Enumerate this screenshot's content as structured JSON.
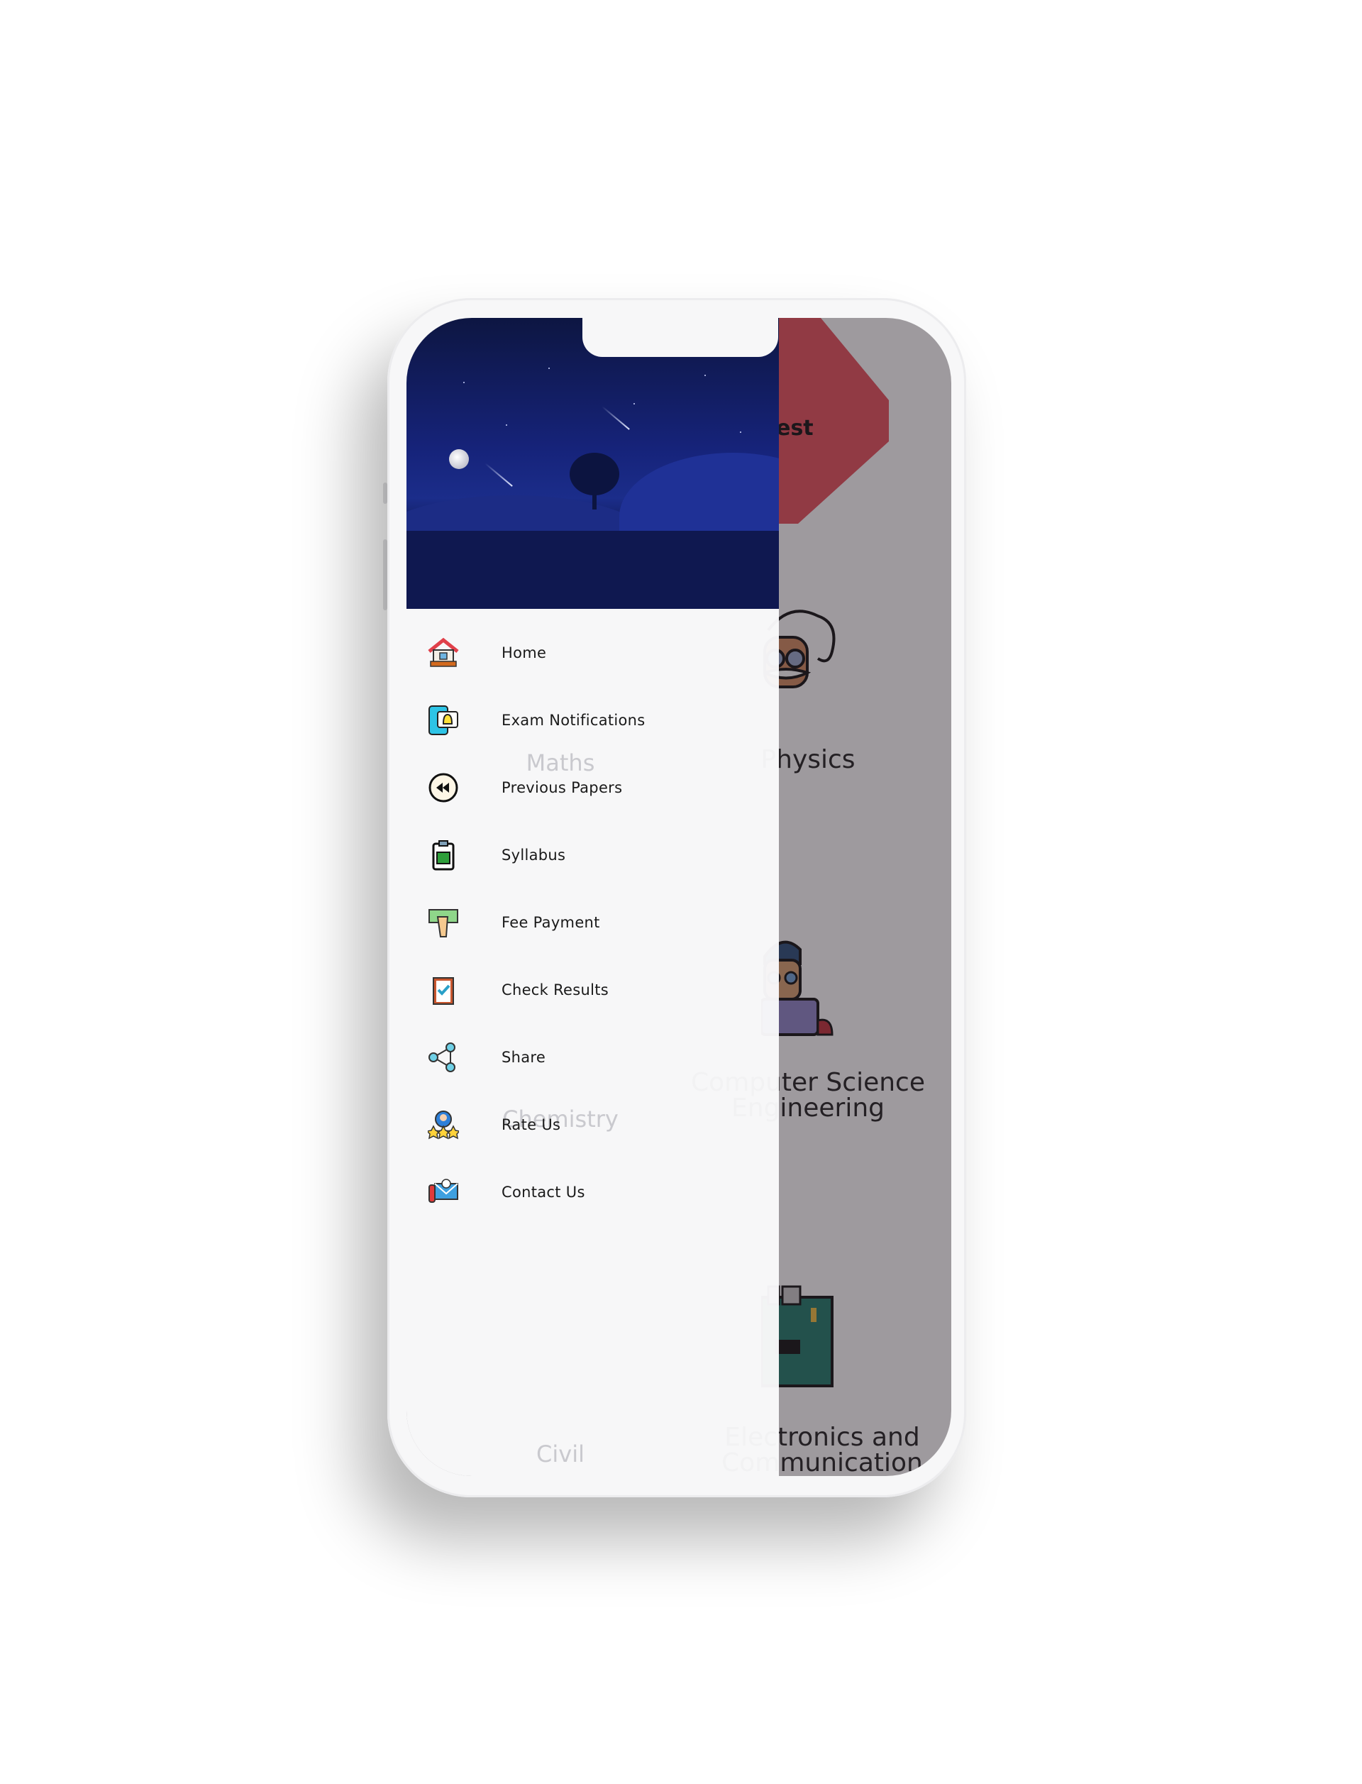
{
  "app": {
    "banner_text": "your test",
    "subjects": [
      "Maths",
      "Physics",
      "Chemistry",
      "Computer Science Engineering",
      "Civil",
      "Electronics and Communication"
    ]
  },
  "drawer": {
    "items": [
      {
        "label": "Home",
        "icon": "home-icon"
      },
      {
        "label": "Exam Notifications",
        "icon": "notification-bell-icon"
      },
      {
        "label": "Previous Papers",
        "icon": "rewind-icon"
      },
      {
        "label": "Syllabus",
        "icon": "clipboard-book-icon"
      },
      {
        "label": "Fee Payment",
        "icon": "money-hand-icon"
      },
      {
        "label": "Check Results",
        "icon": "clipboard-check-icon"
      },
      {
        "label": "Share",
        "icon": "share-icon"
      },
      {
        "label": "Rate Us",
        "icon": "rating-stars-icon"
      },
      {
        "label": "Contact Us",
        "icon": "contact-mail-phone-icon"
      }
    ]
  },
  "colors": {
    "banner": "#e8505b",
    "header": "#16237a",
    "overlay": "#9a9598"
  }
}
